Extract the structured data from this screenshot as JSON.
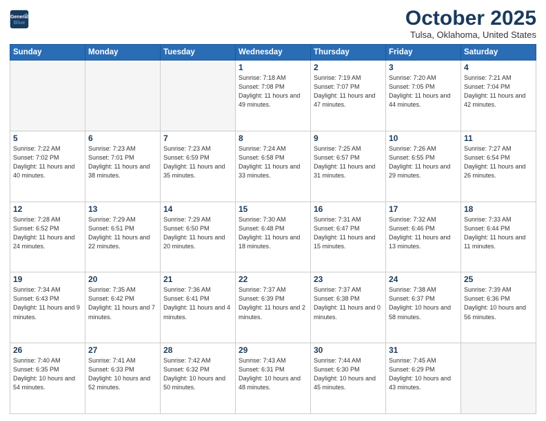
{
  "header": {
    "logo_line1": "General",
    "logo_line2": "Blue",
    "month": "October 2025",
    "location": "Tulsa, Oklahoma, United States"
  },
  "weekdays": [
    "Sunday",
    "Monday",
    "Tuesday",
    "Wednesday",
    "Thursday",
    "Friday",
    "Saturday"
  ],
  "weeks": [
    [
      {
        "day": "",
        "empty": true
      },
      {
        "day": "",
        "empty": true
      },
      {
        "day": "",
        "empty": true
      },
      {
        "day": "1",
        "sunrise": "7:18 AM",
        "sunset": "7:08 PM",
        "daylight": "11 hours and 49 minutes."
      },
      {
        "day": "2",
        "sunrise": "7:19 AM",
        "sunset": "7:07 PM",
        "daylight": "11 hours and 47 minutes."
      },
      {
        "day": "3",
        "sunrise": "7:20 AM",
        "sunset": "7:05 PM",
        "daylight": "11 hours and 44 minutes."
      },
      {
        "day": "4",
        "sunrise": "7:21 AM",
        "sunset": "7:04 PM",
        "daylight": "11 hours and 42 minutes."
      }
    ],
    [
      {
        "day": "5",
        "sunrise": "7:22 AM",
        "sunset": "7:02 PM",
        "daylight": "11 hours and 40 minutes."
      },
      {
        "day": "6",
        "sunrise": "7:23 AM",
        "sunset": "7:01 PM",
        "daylight": "11 hours and 38 minutes."
      },
      {
        "day": "7",
        "sunrise": "7:23 AM",
        "sunset": "6:59 PM",
        "daylight": "11 hours and 35 minutes."
      },
      {
        "day": "8",
        "sunrise": "7:24 AM",
        "sunset": "6:58 PM",
        "daylight": "11 hours and 33 minutes."
      },
      {
        "day": "9",
        "sunrise": "7:25 AM",
        "sunset": "6:57 PM",
        "daylight": "11 hours and 31 minutes."
      },
      {
        "day": "10",
        "sunrise": "7:26 AM",
        "sunset": "6:55 PM",
        "daylight": "11 hours and 29 minutes."
      },
      {
        "day": "11",
        "sunrise": "7:27 AM",
        "sunset": "6:54 PM",
        "daylight": "11 hours and 26 minutes."
      }
    ],
    [
      {
        "day": "12",
        "sunrise": "7:28 AM",
        "sunset": "6:52 PM",
        "daylight": "11 hours and 24 minutes."
      },
      {
        "day": "13",
        "sunrise": "7:29 AM",
        "sunset": "6:51 PM",
        "daylight": "11 hours and 22 minutes."
      },
      {
        "day": "14",
        "sunrise": "7:29 AM",
        "sunset": "6:50 PM",
        "daylight": "11 hours and 20 minutes."
      },
      {
        "day": "15",
        "sunrise": "7:30 AM",
        "sunset": "6:48 PM",
        "daylight": "11 hours and 18 minutes."
      },
      {
        "day": "16",
        "sunrise": "7:31 AM",
        "sunset": "6:47 PM",
        "daylight": "11 hours and 15 minutes."
      },
      {
        "day": "17",
        "sunrise": "7:32 AM",
        "sunset": "6:46 PM",
        "daylight": "11 hours and 13 minutes."
      },
      {
        "day": "18",
        "sunrise": "7:33 AM",
        "sunset": "6:44 PM",
        "daylight": "11 hours and 11 minutes."
      }
    ],
    [
      {
        "day": "19",
        "sunrise": "7:34 AM",
        "sunset": "6:43 PM",
        "daylight": "11 hours and 9 minutes."
      },
      {
        "day": "20",
        "sunrise": "7:35 AM",
        "sunset": "6:42 PM",
        "daylight": "11 hours and 7 minutes."
      },
      {
        "day": "21",
        "sunrise": "7:36 AM",
        "sunset": "6:41 PM",
        "daylight": "11 hours and 4 minutes."
      },
      {
        "day": "22",
        "sunrise": "7:37 AM",
        "sunset": "6:39 PM",
        "daylight": "11 hours and 2 minutes."
      },
      {
        "day": "23",
        "sunrise": "7:37 AM",
        "sunset": "6:38 PM",
        "daylight": "11 hours and 0 minutes."
      },
      {
        "day": "24",
        "sunrise": "7:38 AM",
        "sunset": "6:37 PM",
        "daylight": "10 hours and 58 minutes."
      },
      {
        "day": "25",
        "sunrise": "7:39 AM",
        "sunset": "6:36 PM",
        "daylight": "10 hours and 56 minutes."
      }
    ],
    [
      {
        "day": "26",
        "sunrise": "7:40 AM",
        "sunset": "6:35 PM",
        "daylight": "10 hours and 54 minutes."
      },
      {
        "day": "27",
        "sunrise": "7:41 AM",
        "sunset": "6:33 PM",
        "daylight": "10 hours and 52 minutes."
      },
      {
        "day": "28",
        "sunrise": "7:42 AM",
        "sunset": "6:32 PM",
        "daylight": "10 hours and 50 minutes."
      },
      {
        "day": "29",
        "sunrise": "7:43 AM",
        "sunset": "6:31 PM",
        "daylight": "10 hours and 48 minutes."
      },
      {
        "day": "30",
        "sunrise": "7:44 AM",
        "sunset": "6:30 PM",
        "daylight": "10 hours and 45 minutes."
      },
      {
        "day": "31",
        "sunrise": "7:45 AM",
        "sunset": "6:29 PM",
        "daylight": "10 hours and 43 minutes."
      },
      {
        "day": "",
        "empty": true
      }
    ]
  ]
}
